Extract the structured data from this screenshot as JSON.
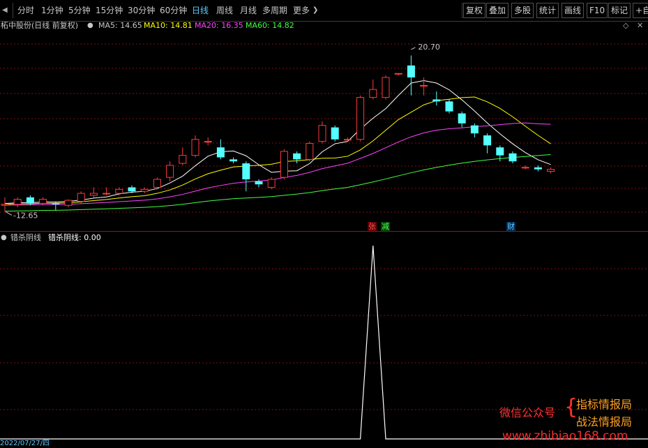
{
  "toolbar": {
    "periods": [
      "分时",
      "1分钟",
      "5分钟",
      "15分钟",
      "30分钟",
      "60分钟",
      "日线",
      "周线",
      "月线",
      "多周期",
      "更多"
    ],
    "active_period": "日线",
    "right_buttons": [
      "复权",
      "叠加",
      "多股",
      "统计",
      "画线",
      "F10",
      "标记",
      "+自"
    ]
  },
  "stock": {
    "title": "柘中股份(日线 前复权)",
    "ma": [
      {
        "label": "MA5: 14.65",
        "color": "#ffffff"
      },
      {
        "label": "MA10: 14.81",
        "color": "#ffff00"
      },
      {
        "label": "MA20: 16.35",
        "color": "#ff44ff"
      },
      {
        "label": "MA60: 14.82",
        "color": "#44ff44"
      }
    ]
  },
  "annotations": {
    "high_label": "20.70",
    "low_label": "12.65",
    "markers": [
      {
        "text": "张",
        "color": "#ff5555",
        "bg": "#5a0000"
      },
      {
        "text": "减",
        "color": "#55ff55",
        "bg": "#004400"
      },
      {
        "text": "财",
        "color": "#5ecbff",
        "bg": "#002a55"
      }
    ]
  },
  "indicator": {
    "name": "错杀阴线",
    "value_label": "错杀阴线: 0.00"
  },
  "bottom_date": "2022/07/27/四",
  "watermark": {
    "left": "微信公众号",
    "line1": "指标情报局",
    "line2": "战法情报局",
    "url": "www.zhibiao168.com"
  },
  "chart_data": {
    "type": "candlestick",
    "price_range": [
      12.0,
      21.5
    ],
    "high": 20.7,
    "low": 12.65,
    "candles": [
      [
        12.9,
        12.95,
        13.3,
        12.6
      ],
      [
        12.95,
        13.2,
        13.3,
        12.8
      ],
      [
        13.3,
        13.0,
        13.4,
        12.9
      ],
      [
        13.0,
        13.2,
        13.3,
        12.9
      ],
      [
        13.0,
        12.95,
        13.1,
        12.65
      ],
      [
        12.9,
        13.15,
        13.2,
        12.8
      ],
      [
        13.1,
        13.5,
        13.6,
        13.0
      ],
      [
        13.4,
        13.5,
        13.8,
        13.3
      ],
      [
        13.5,
        13.5,
        13.8,
        13.4
      ],
      [
        13.5,
        13.7,
        13.8,
        13.4
      ],
      [
        13.8,
        13.6,
        13.9,
        13.5
      ],
      [
        13.6,
        13.7,
        13.8,
        13.5
      ],
      [
        13.8,
        14.2,
        14.3,
        13.7
      ],
      [
        14.3,
        14.9,
        15.1,
        14.1
      ],
      [
        15.0,
        15.4,
        15.8,
        14.9
      ],
      [
        15.4,
        16.2,
        16.4,
        15.3
      ],
      [
        16.1,
        16.1,
        16.3,
        15.9
      ],
      [
        15.8,
        15.3,
        16.2,
        15.2
      ],
      [
        15.2,
        15.1,
        15.3,
        15.0
      ],
      [
        15.0,
        14.2,
        15.1,
        13.6
      ],
      [
        14.1,
        13.95,
        14.2,
        13.8
      ],
      [
        13.8,
        14.2,
        14.3,
        13.7
      ],
      [
        14.3,
        15.6,
        15.7,
        14.2
      ],
      [
        15.5,
        15.2,
        15.6,
        15.0
      ],
      [
        15.2,
        16.0,
        16.1,
        15.1
      ],
      [
        16.1,
        16.9,
        17.1,
        16.0
      ],
      [
        16.8,
        16.2,
        16.9,
        16.1
      ],
      [
        16.2,
        16.2,
        16.3,
        16.1
      ],
      [
        16.2,
        18.3,
        18.4,
        16.1
      ],
      [
        18.3,
        18.7,
        19.2,
        18.2
      ],
      [
        18.3,
        19.3,
        19.4,
        18.2
      ],
      [
        19.5,
        19.5,
        19.5,
        19.4
      ],
      [
        19.9,
        19.3,
        20.4,
        18.4
      ],
      [
        18.9,
        18.9,
        19.3,
        18.4
      ],
      [
        18.2,
        18.1,
        18.6,
        17.9
      ],
      [
        18.1,
        17.6,
        18.2,
        17.5
      ],
      [
        17.5,
        17.0,
        17.6,
        16.8
      ],
      [
        16.9,
        16.5,
        17.0,
        16.3
      ],
      [
        16.4,
        15.9,
        16.5,
        15.5
      ],
      [
        15.8,
        15.4,
        15.9,
        15.1
      ],
      [
        15.5,
        15.1,
        15.6,
        15.0
      ],
      [
        14.8,
        14.8,
        14.9,
        14.7
      ],
      [
        14.8,
        14.7,
        14.9,
        14.6
      ],
      [
        14.6,
        14.7,
        14.8,
        14.5
      ]
    ]
  }
}
